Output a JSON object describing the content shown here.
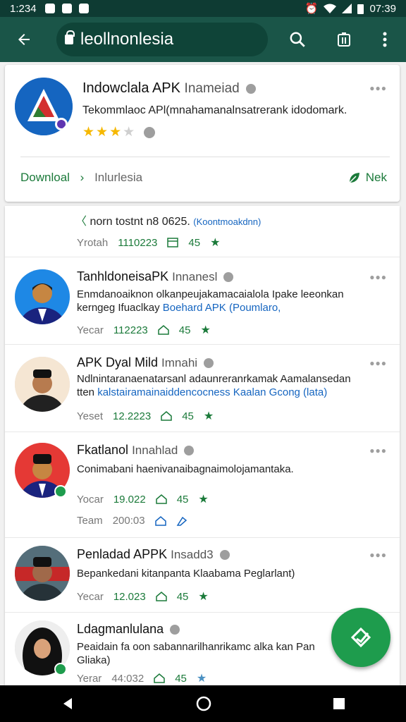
{
  "status": {
    "time": "1:234",
    "clock": "07:39"
  },
  "toolbar": {
    "url": "leollnonlesia"
  },
  "top_card": {
    "title": "Indowclala APK",
    "subtitle": "Inameiad",
    "description": "Tekommlaoc APl(mnahamanalnsatrerank idodomark.",
    "rating_stars": 3,
    "download_label": "Downloal",
    "location": "Inlurlesia",
    "action_label": "Nek"
  },
  "partial_item": {
    "line": "norn  tostnt  n8 0625.",
    "blue": "(Koontmoakdnn)",
    "year_label": "Yrotah",
    "date": "1110223",
    "count": "45"
  },
  "items": [
    {
      "title": "TanhldoneisaPK",
      "subtitle": "Innanesl",
      "desc1": "Enmdanoaiknon olkanpeujakamacaialola Ipake leeonkan",
      "desc2a": "kerngeg Ifuaclkay",
      "desc2b": "Boehard APK (Poumlaro,",
      "year_label": "Yecar",
      "date": "112223",
      "count": "45"
    },
    {
      "title": "APK Dyal Mild",
      "subtitle": "Imnahi",
      "desc1": "Ndlnintaranaenatarsanl adaunreranrkamak Aamalansedan",
      "desc2a": "tten",
      "desc2b": "kalstairamainaiddencocness Kaalan Gcong (lata)",
      "year_label": "Yeset",
      "date": "12.2223",
      "count": "45"
    },
    {
      "title": "Fkatlanol",
      "subtitle": "Innahlad",
      "desc1": "Conimabani haenivanaibagnaimolojamantaka.",
      "year_label": "Yocar",
      "date": "19.022",
      "count": "45",
      "extra_label": "Team",
      "extra_date": "200:03"
    },
    {
      "title": "Penladad APPK",
      "subtitle": "Insadd3",
      "desc1": "Bepankedani kitanpanta Klaabama Peglarlant)",
      "year_label": "Yecar",
      "date": "12.023",
      "count": "45"
    },
    {
      "title": "Ldagmanlulana",
      "subtitle": "",
      "desc1": "Peaidain fa oon sabannarilhanrikamc alka kan Pan",
      "desc2a": "Gliaka)",
      "desc2b": "",
      "year_label": "Yerar",
      "date": "44:032",
      "count": "45"
    }
  ],
  "colors": {
    "header": "#1a5548",
    "status": "#0e3b33",
    "accent": "#1b7a3a",
    "fab": "#1e9c4d"
  }
}
